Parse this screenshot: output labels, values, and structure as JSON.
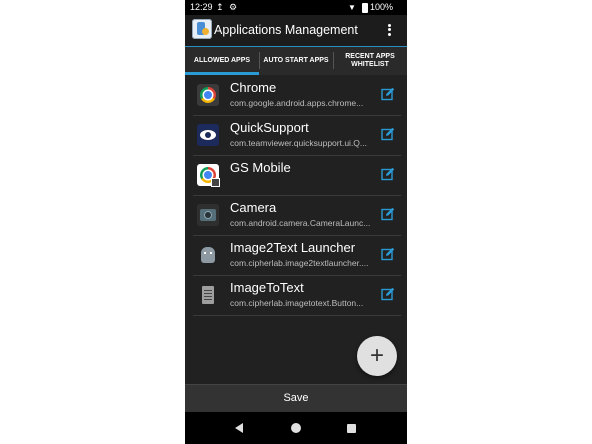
{
  "status_bar": {
    "time": "12:29",
    "battery": "100%",
    "icons": [
      "upload-icon",
      "sync-icon",
      "wifi-icon",
      "battery-icon"
    ]
  },
  "app_bar": {
    "title": "Applications Management",
    "icon": "app-management-icon",
    "menu_icon": "overflow-menu-icon"
  },
  "tabs": [
    {
      "label": "ALLOWED APPS",
      "selected": true
    },
    {
      "label": "AUTO START APPS",
      "selected": false
    },
    {
      "label": "RECENT APPS WHITELIST",
      "selected": false
    }
  ],
  "apps": [
    {
      "name": "Chrome",
      "package": "com.google.android.apps.chrome...",
      "icon": "chrome-icon"
    },
    {
      "name": "QuickSupport",
      "package": "com.teamviewer.quicksupport.ui.Q...",
      "icon": "quicksupport-icon"
    },
    {
      "name": "GS Mobile",
      "package": "",
      "icon": "gs-mobile-icon"
    },
    {
      "name": "Camera",
      "package": "com.android.camera.CameraLaunc...",
      "icon": "camera-icon"
    },
    {
      "name": "Image2Text Launcher",
      "package": "com.cipherlab.image2textlauncher....",
      "icon": "image2text-icon"
    },
    {
      "name": "ImageToText",
      "package": "com.cipherlab.imagetotext.Button...",
      "icon": "imagetotext-icon"
    }
  ],
  "fab": {
    "symbol": "+",
    "icon": "plus-icon"
  },
  "save_label": "Save",
  "colors": {
    "accent": "#2b9bd6",
    "background": "#212121",
    "edit_icon": "#2b9bd6"
  }
}
